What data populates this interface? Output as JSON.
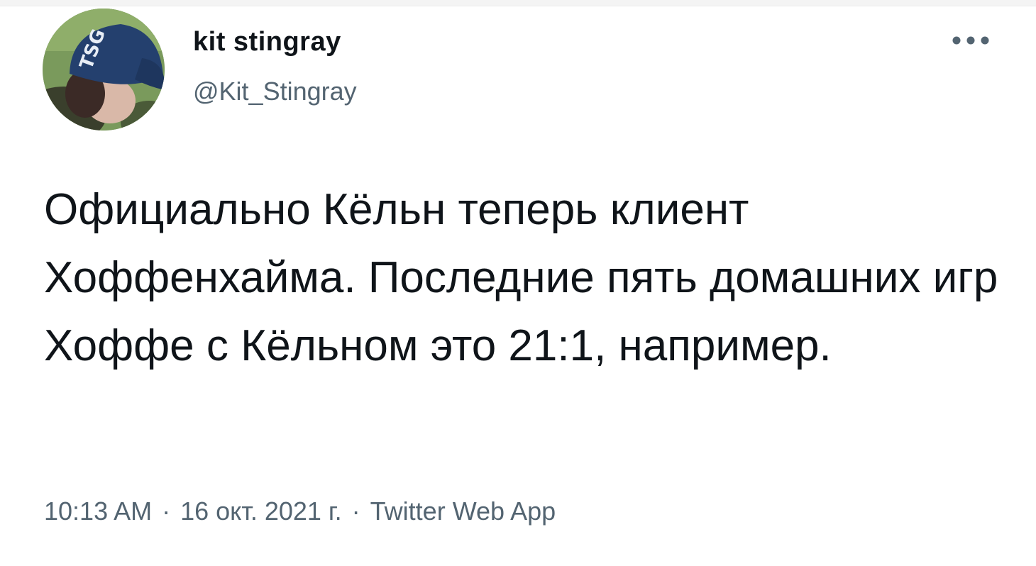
{
  "author": {
    "name": "kit stingray",
    "handle": "@Kit_Stingray",
    "avatar_icon": "profile-photo-icon"
  },
  "tweet": {
    "text": "Официально Кёльн теперь клиент Хоффенхайма. Последние пять домашних игр Хоффе с Кёльном это 21:1, например.",
    "time": "10:13 AM",
    "date": "16 окт. 2021 г.",
    "separator": "·",
    "source": "Twitter Web App"
  },
  "icons": {
    "more": "more-options-icon"
  },
  "colors": {
    "text_primary": "#0f1419",
    "text_secondary": "#536471",
    "background": "#ffffff"
  }
}
